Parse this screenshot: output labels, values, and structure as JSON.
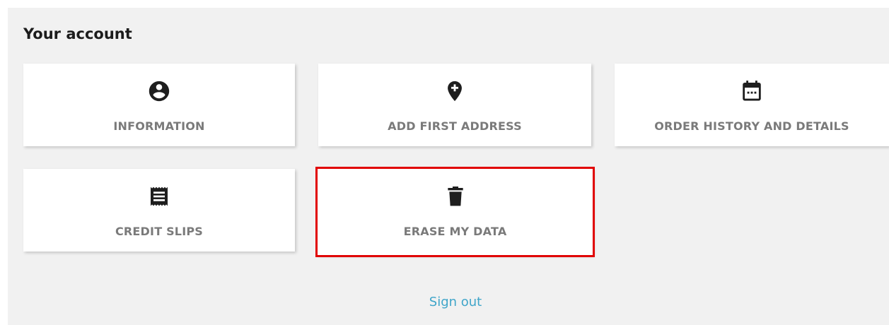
{
  "page": {
    "title": "Your account",
    "highlight_color": "#e10000",
    "link_color": "#3fa5c9"
  },
  "tiles": [
    {
      "label": "INFORMATION",
      "icon": "account-circle-icon"
    },
    {
      "label": "ADD FIRST ADDRESS",
      "icon": "add-location-icon"
    },
    {
      "label": "ORDER HISTORY AND DETAILS",
      "icon": "calendar-icon"
    },
    {
      "label": "CREDIT SLIPS",
      "icon": "receipt-icon"
    },
    {
      "label": "ERASE MY DATA",
      "icon": "trash-icon",
      "highlighted": true
    }
  ],
  "footer": {
    "sign_out_label": "Sign out"
  }
}
